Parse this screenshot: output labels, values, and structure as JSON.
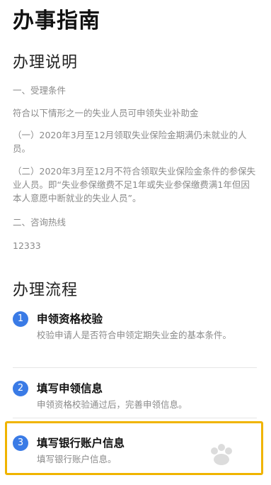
{
  "header": {
    "title": "办事指南"
  },
  "instructions": {
    "title": "办理说明",
    "condition_heading": "一、受理条件",
    "condition_intro": "符合以下情形之一的失业人员可申领失业补助金",
    "case_1": "（一）2020年3月至12月领取失业保险金期满仍未就业的人员。",
    "case_2": "（二）2020年3月至12月不符合领取失业保险金条件的参保失业人员。即“失业参保缴费不足1年或失业参保缴费满1年但因本人意愿中断就业的失业人员”。",
    "hotline_heading": "二、咨询热线",
    "hotline_number": "12333"
  },
  "process": {
    "title": "办理流程",
    "steps": [
      {
        "number": "1",
        "title": "申领资格校验",
        "description": "校验申请人是否符合申领定期失业金的基本条件。"
      },
      {
        "number": "2",
        "title": "填写申领信息",
        "description": "申领资格校验通过后，完善申领信息。"
      },
      {
        "number": "3",
        "title": "填写银行账户信息",
        "description": "填写银行账户信息。"
      }
    ]
  },
  "colors": {
    "accent": "#3a7be6",
    "highlight": "#f0b400",
    "muted_text": "#8a8a8a"
  }
}
